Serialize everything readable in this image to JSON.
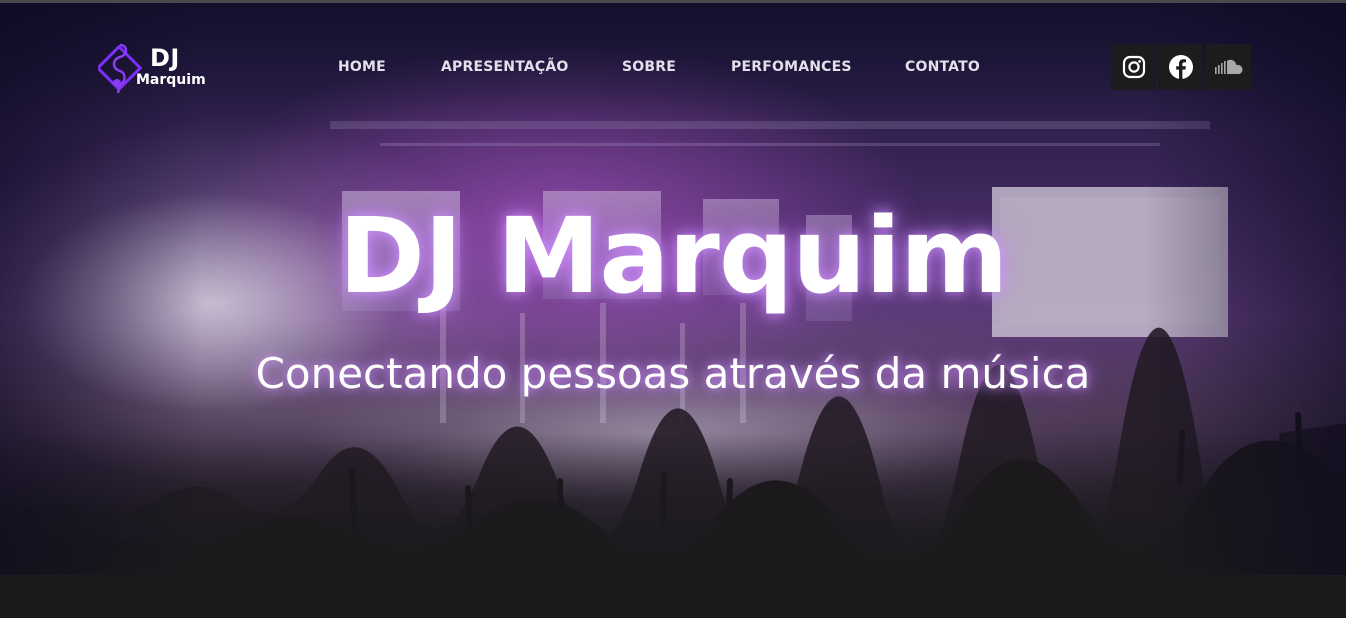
{
  "brand": {
    "logo_line1": "DJ",
    "logo_line2": "Marquim",
    "accent_color": "#7b2ff7"
  },
  "nav": {
    "items": [
      {
        "label": "HOME"
      },
      {
        "label": "APRESENTAÇÃO"
      },
      {
        "label": "SOBRE"
      },
      {
        "label": "PERFOMANCES"
      },
      {
        "label": "CONTATO"
      }
    ]
  },
  "social": [
    {
      "icon": "instagram-icon"
    },
    {
      "icon": "facebook-icon"
    },
    {
      "icon": "soundcloud-icon"
    }
  ],
  "hero": {
    "title": "DJ Marquim",
    "subtitle": "Conectando pessoas através da música",
    "glow_color": "#c98cff"
  }
}
